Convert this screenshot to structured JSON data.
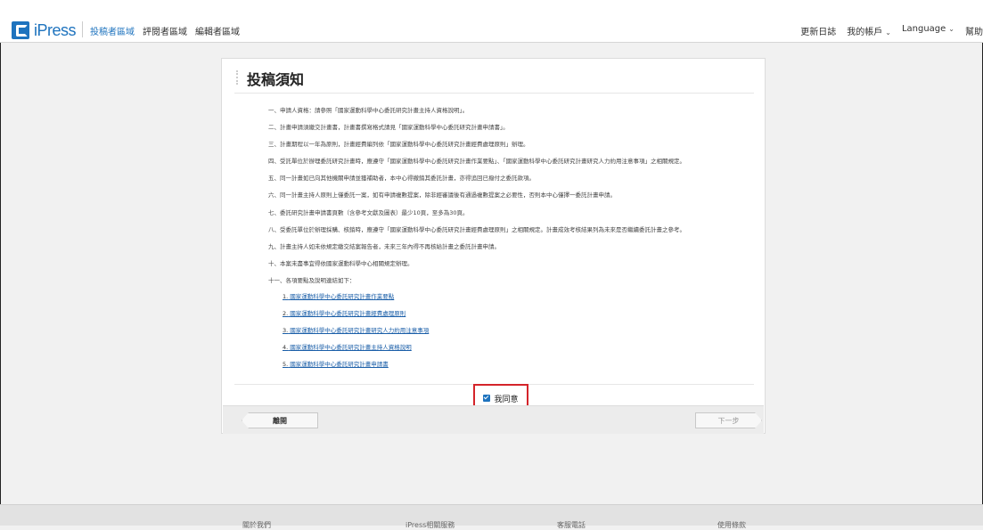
{
  "header": {
    "logo_text": "iPress",
    "nav": [
      "投稿者區域",
      "評閱者區域",
      "編輯者區域"
    ],
    "right": {
      "changelog": "更新日誌",
      "account": "我的帳戶",
      "language": "Language",
      "help": "幫助"
    }
  },
  "card": {
    "title": "投稿須知",
    "items": [
      "一、申請人資格：請參照「國家運動科學中心委託研究計畫主持人資格說明」。",
      "二、計畫申請須繳交計畫書，計畫書撰寫格式請見「國家運動科學中心委託研究計畫申請書」。",
      "三、計畫期程以一年為原則，計畫經費編列依「國家運動科學中心委託研究計畫經費處理原則」辦理。",
      "四、受託單位於辦理委託研究計畫時，應遵守「國家運動科學中心委託研究計畫作業要點」、「國家運動科學中心委託研究計畫研究人力約用注意事項」之相關規定。",
      "五、同一計畫如已向其他機關申請並獲補助者，本中心得撤銷其委託計畫，亦得追回已撥付之委託款項。",
      "六、同一計畫主持人原則上僅委託一案，如有申請複數提案，除非經審議後有通過複數提案之必要性，否則本中心僅擇一委託計畫申請。",
      "七、委託研究計畫申請書頁數（含參考文獻及圖表）最少10頁，至多為30頁。",
      "八、受委託單位於辦理採購、核銷時，應遵守「國家運動科學中心委託研究計畫經費處理原則」之相關規定。計畫成效考核結果列為未來是否繼續委託計畫之參考。",
      "九、計畫主持人如未依規定繳交結案報告者，未來三年內得不再核給計畫之委託計畫申請。",
      "十、本案未盡事宜得依國家運動科學中心相關規定辦理。",
      "十一、各項要點及說明連結如下："
    ],
    "links": [
      {
        "num": "1.",
        "text": "國家運動科學中心委託研究計畫作業要點"
      },
      {
        "num": "2.",
        "text": "國家運動科學中心委託研究計畫經費處理原則"
      },
      {
        "num": "3.",
        "text": "國家運動科學中心委託研究計畫研究人力約用注意事項"
      },
      {
        "num": "4.",
        "text": "國家運動科學中心委託研究計畫主持人資格說明"
      },
      {
        "num": "5.",
        "text": "國家運動科學中心委託研究計畫申請書"
      }
    ],
    "agree_label": "我同意",
    "back_label": "離開",
    "next_label": "下一步"
  },
  "footer": [
    "關於我們",
    "iPress相關服務",
    "客服電話",
    "使用條款"
  ],
  "colors": {
    "brand": "#1e73be",
    "highlight": "#d4242a"
  }
}
